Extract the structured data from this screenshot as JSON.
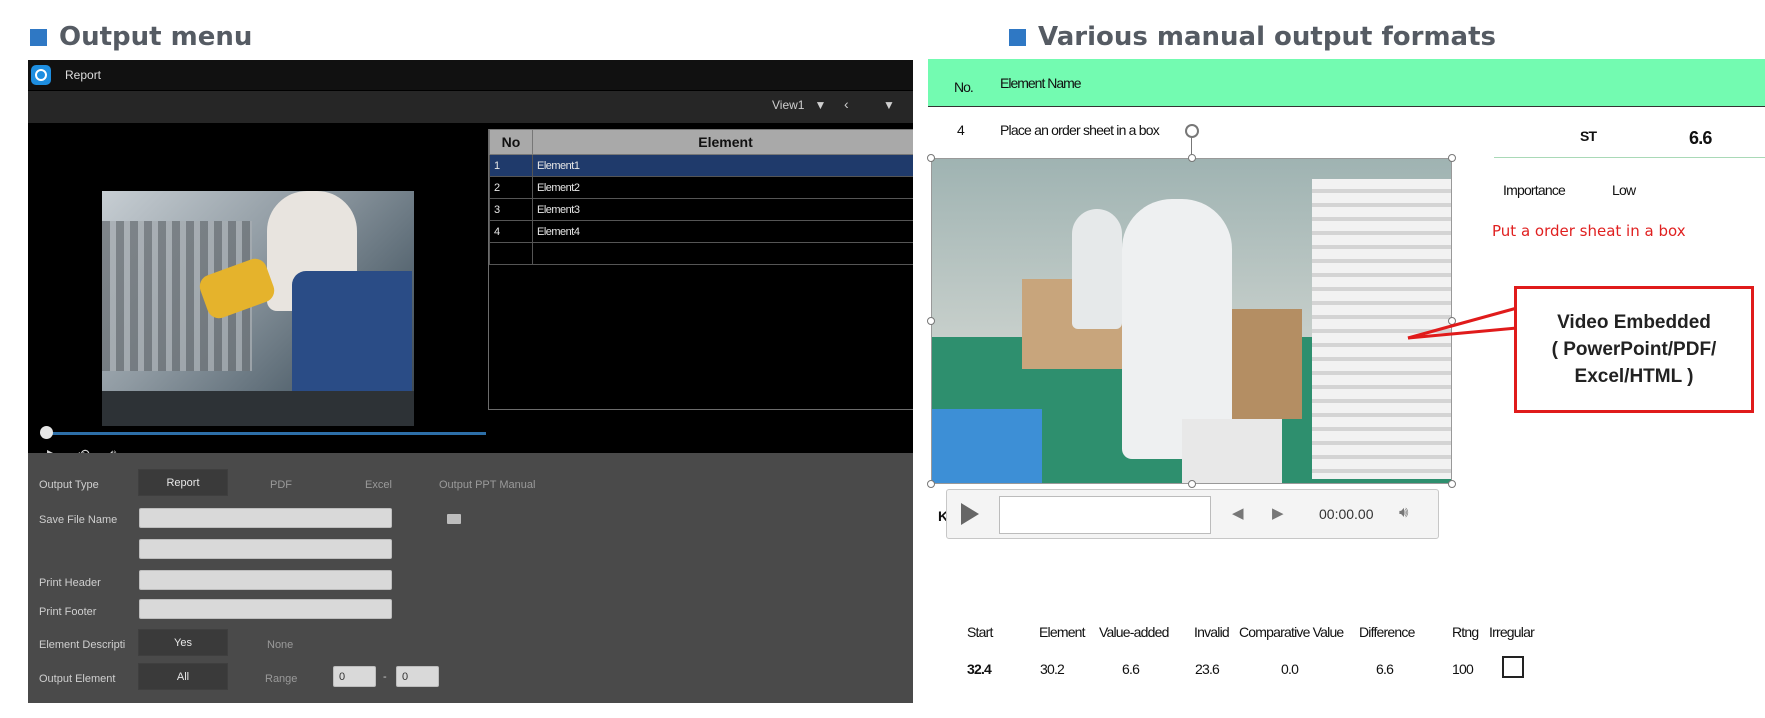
{
  "left": {
    "section_title": "Output menu",
    "app": {
      "title": "Report",
      "toolbar": {
        "view": "View1",
        "prev": "‹",
        "menu": "▼"
      },
      "table": {
        "headers": [
          "No",
          "Element"
        ],
        "rows": [
          {
            "no": "1",
            "element": "Element1"
          },
          {
            "no": "2",
            "element": "Element2"
          },
          {
            "no": "3",
            "element": "Element3"
          },
          {
            "no": "4",
            "element": "Element4"
          },
          {
            "no": "",
            "element": ""
          }
        ]
      },
      "form": {
        "output_type_label": "Output Type",
        "output_types": [
          "Report",
          "PDF",
          "Excel",
          "Output PPT Manual"
        ],
        "save_file_name_label": "Save File Name",
        "print_header_label": "Print Header",
        "print_footer_label": "Print Footer",
        "element_description_label": "Element Descripti",
        "element_description_yes": "Yes",
        "element_description_none": "None",
        "output_element_label": "Output Element",
        "output_element_all": "All",
        "range_label": "Range",
        "range_from": "0",
        "range_to": "0",
        "range_sep": "-"
      }
    }
  },
  "right": {
    "section_title": "Various manual output formats",
    "header": {
      "no": "No.",
      "element_name": "Element Name"
    },
    "row": {
      "no": "4",
      "element_name": "Place an order sheet in a box"
    },
    "st_label": "ST",
    "st_value": "6.6",
    "importance_label": "Importance",
    "importance_value": "Low",
    "note": "Put a order sheat in a box",
    "k_letter": "K",
    "player": {
      "time": "00:00.00"
    },
    "callout": {
      "line1": "Video Embedded",
      "line2": "( PowerPoint/PDF/",
      "line3": "Excel/HTML )"
    },
    "summary": {
      "headers": [
        "Start",
        "Element",
        "Value-added",
        "Invalid",
        "Comparative Value",
        "Difference",
        "Rtng",
        "Irregular"
      ],
      "values": [
        "32.4",
        "30.2",
        "6.6",
        "23.6",
        "0.0",
        "6.6",
        "100"
      ]
    },
    "colors": {
      "header_bar": "#73fbb1",
      "callout_border": "#e01b1b",
      "note": "#e02020",
      "heading_square": "#2f78c4"
    }
  }
}
